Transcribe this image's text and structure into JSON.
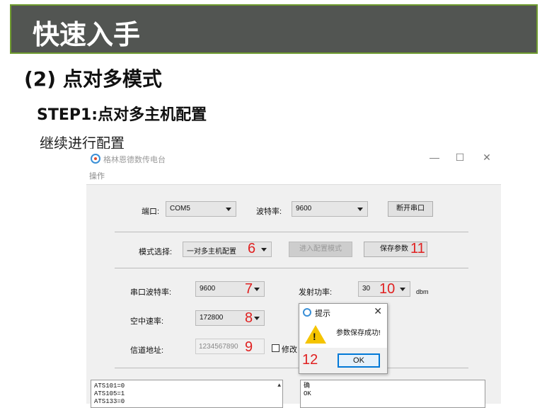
{
  "slide": {
    "banner_title": "快速入手",
    "heading2": "(2) 点对多模式",
    "heading3": "STEP1:点对多主机配置",
    "paragraph": "继续进行配置"
  },
  "window": {
    "title": "格林恩德数传电台",
    "menu": "操作",
    "minimize": "—",
    "maximize": "☐",
    "close": "✕"
  },
  "serial": {
    "port_label": "端口:",
    "port_value": "COM5",
    "baud_label": "波特率:",
    "baud_value": "9600",
    "disconnect_button": "断开串口"
  },
  "mode": {
    "label": "模式选择:",
    "value": "一对多主机配置",
    "enter_config_button": "进入配置模式",
    "save_button": "保存参数"
  },
  "params": {
    "uart_baud_label": "串口波特率:",
    "uart_baud_value": "9600",
    "air_rate_label": "空中速率:",
    "air_rate_value": "172800",
    "channel_label": "信道地址:",
    "channel_value": "1234567890",
    "modify_label": "修改",
    "tx_power_label": "发射功率:",
    "tx_power_value": "30",
    "tx_power_unit": "dbm"
  },
  "annotations": {
    "n6": "6",
    "n7": "7",
    "n8": "8",
    "n9": "9",
    "n10": "10",
    "n11": "11",
    "n12": "12"
  },
  "log_left": [
    "ATS101=0",
    "ATS105=1",
    "ATS133=0"
  ],
  "log_right": [
    "确",
    "OK"
  ],
  "dialog": {
    "title": "提示",
    "message": "参数保存成功!",
    "ok_button": "OK"
  }
}
